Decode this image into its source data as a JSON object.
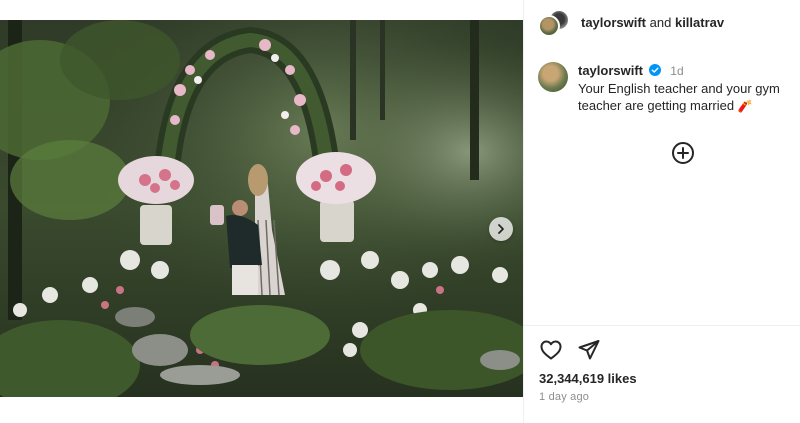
{
  "header": {
    "user1": "taylorswift",
    "joiner": "and",
    "user2": "killatrav"
  },
  "caption": {
    "username": "taylorswift",
    "verified": true,
    "time": "1d",
    "text": "Your English teacher and your gym teacher are getting married",
    "emoji": "🧨"
  },
  "media": {
    "description_icon": "photo",
    "has_next": true
  },
  "icons": {
    "like": "heart-icon",
    "share": "paper-plane-icon",
    "more_comments": "plus-circle-icon",
    "next": "chevron-right-icon",
    "verified": "verified-badge-icon"
  },
  "stats": {
    "likes": "32,344,619 likes",
    "ago": "1 day ago"
  },
  "colors": {
    "verified": "#0095f6",
    "text": "#262626",
    "muted": "#8e8e8e"
  }
}
